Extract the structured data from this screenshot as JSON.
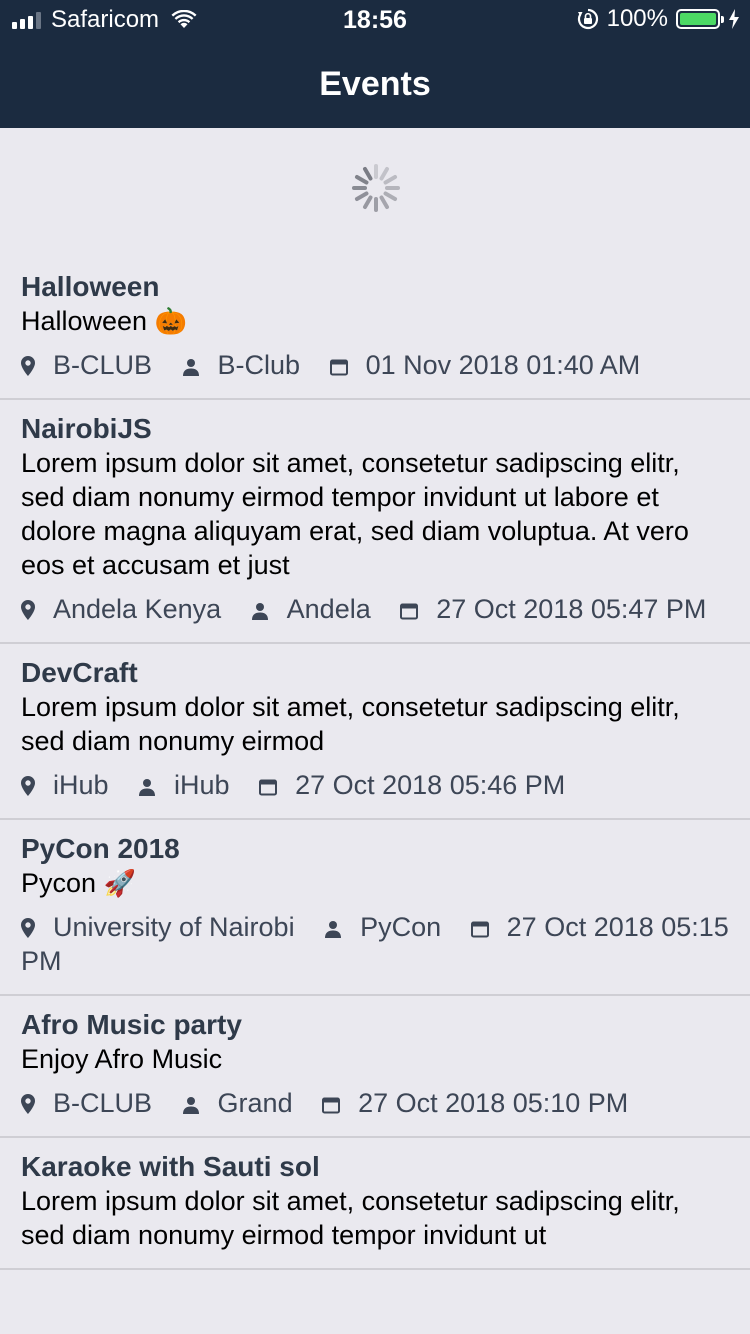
{
  "status_bar": {
    "carrier": "Safaricom",
    "time": "18:56",
    "battery": "100%",
    "battery_level": 1.0
  },
  "header": {
    "title": "Events"
  },
  "events": [
    {
      "title": "Halloween",
      "description": "Halloween",
      "emoji": "🎃",
      "venue": "B-CLUB",
      "organizer": "B-Club",
      "datetime": "01 Nov 2018 01:40 AM"
    },
    {
      "title": "NairobiJS",
      "description": "Lorem ipsum dolor sit amet, consetetur sadipscing elitr, sed diam nonumy eirmod tempor invidunt ut labore et dolore magna aliquyam erat, sed diam voluptua. At vero eos et accusam et just",
      "emoji": "",
      "venue": "Andela Kenya",
      "organizer": "Andela",
      "datetime": "27 Oct 2018 05:47 PM"
    },
    {
      "title": "DevCraft",
      "description": "Lorem ipsum dolor sit amet, consetetur sadipscing elitr, sed diam nonumy eirmod",
      "emoji": "",
      "venue": "iHub",
      "organizer": "iHub",
      "datetime": "27 Oct 2018 05:46 PM"
    },
    {
      "title": "PyCon 2018",
      "description": "Pycon",
      "emoji": "🚀",
      "venue": "University of Nairobi",
      "organizer": "PyCon",
      "datetime": "27 Oct 2018 05:15 PM"
    },
    {
      "title": "Afro Music party",
      "description": "Enjoy Afro Music",
      "emoji": "",
      "venue": "B-CLUB",
      "organizer": "Grand",
      "datetime": "27 Oct 2018 05:10 PM"
    },
    {
      "title": "Karaoke with Sauti sol",
      "description": "Lorem ipsum dolor sit amet, consetetur sadipscing elitr, sed diam nonumy eirmod tempor invidunt ut",
      "emoji": "",
      "venue": "",
      "organizer": "",
      "datetime": ""
    }
  ],
  "icons": {
    "venue": "location-pin-icon",
    "organizer": "person-icon",
    "datetime": "calendar-icon"
  },
  "colors": {
    "nav_background": "#1b2b40",
    "page_background": "#eae9ef",
    "title_text": "#2f3a49",
    "meta_text": "#3d4656",
    "battery_fill": "#4cd964"
  }
}
